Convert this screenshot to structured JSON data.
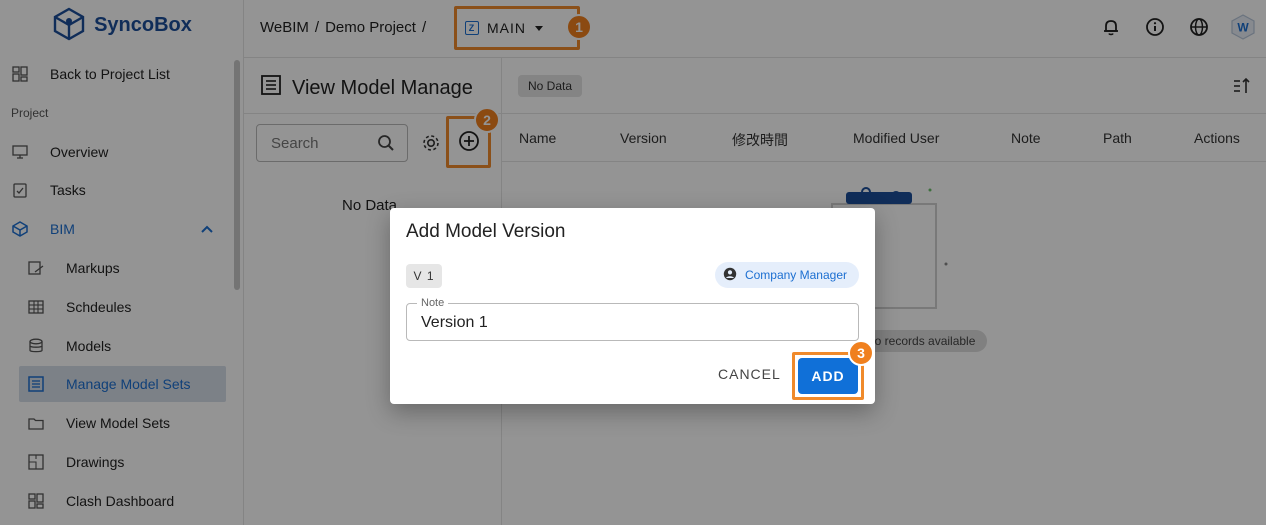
{
  "brand": {
    "name": "SyncoBox",
    "color": "#1c4e9a"
  },
  "sidebar": {
    "back_label": "Back to Project List",
    "section_label": "Project",
    "items": {
      "overview": "Overview",
      "tasks": "Tasks",
      "bim": "BIM",
      "markups": "Markups",
      "schedules": "Schdeules",
      "models": "Models",
      "manage_model_sets": "Manage Model Sets",
      "view_model_sets": "View Model Sets",
      "drawings": "Drawings",
      "clash_dashboard": "Clash Dashboard"
    }
  },
  "header": {
    "crumb_1": "WeBIM",
    "crumb_sep": "/",
    "crumb_2": "Demo Project",
    "branch_icon_letter": "Z",
    "branch_label": "MAIN",
    "avatar_letter": "W"
  },
  "left_panel": {
    "title": "View Model Manage",
    "search_placeholder": "Search",
    "no_data": "No Data"
  },
  "content": {
    "chip": "No Data",
    "columns": [
      "Name",
      "Version",
      "修改時間",
      "Modified User",
      "Note",
      "Path",
      "Actions"
    ],
    "empty_text": "No records available"
  },
  "dialog": {
    "title": "Add Model Version",
    "version_chip": "V 1",
    "role_chip": "Company Manager",
    "note_label": "Note",
    "note_value": "Version 1",
    "cancel_label": "CANCEL",
    "add_label": "ADD"
  },
  "callouts": {
    "one": "1",
    "two": "2",
    "three": "3"
  },
  "colors": {
    "accent": "#1070d8",
    "callout": "#f0801e"
  }
}
